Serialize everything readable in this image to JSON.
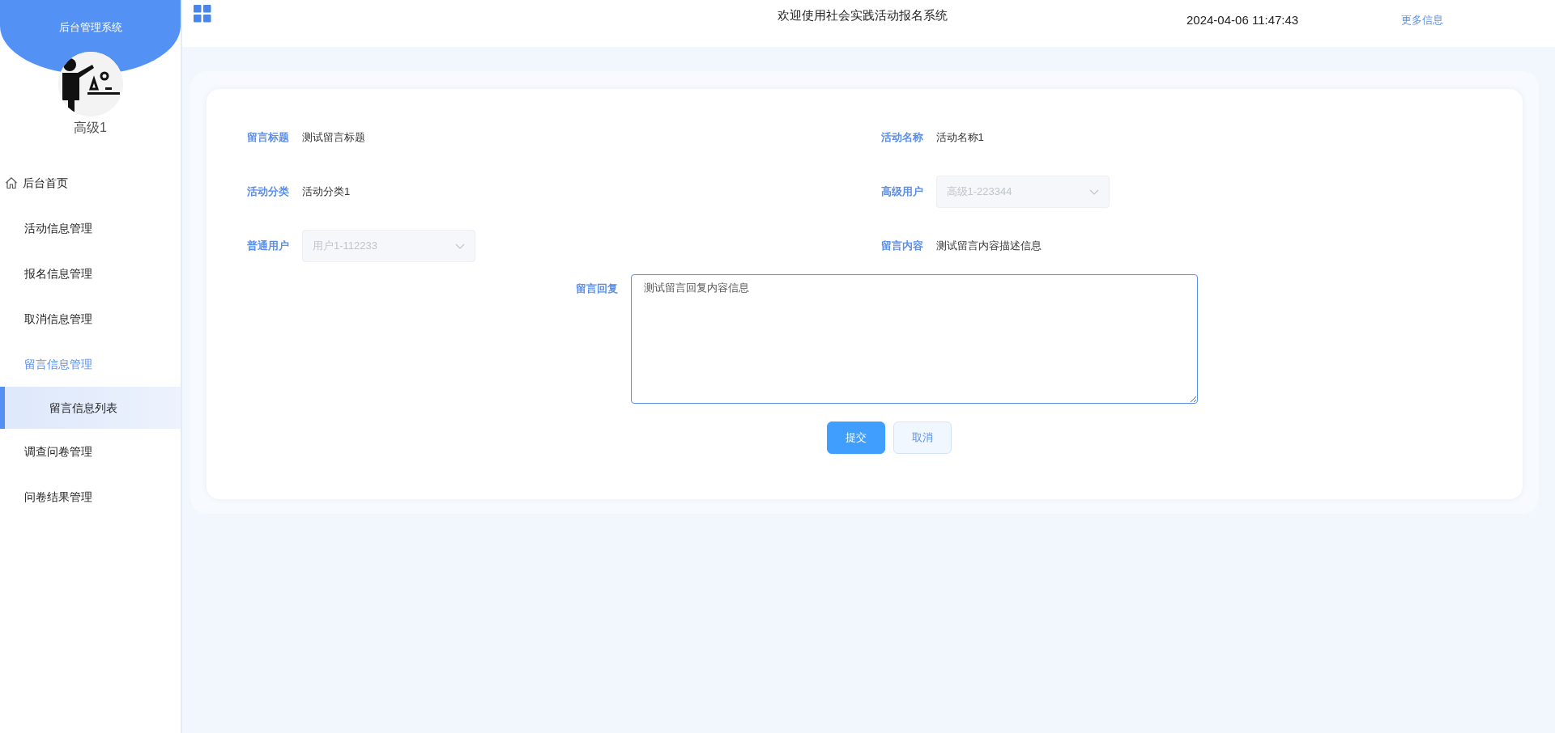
{
  "sidebar": {
    "title": "后台管理系统",
    "user": "高级1",
    "menu": [
      {
        "label": "后台首页",
        "kind": "home",
        "selected": false,
        "expanded": false
      },
      {
        "label": "活动信息管理",
        "kind": "group",
        "selected": false,
        "expanded": false
      },
      {
        "label": "报名信息管理",
        "kind": "group",
        "selected": false,
        "expanded": false
      },
      {
        "label": "取消信息管理",
        "kind": "group",
        "selected": false,
        "expanded": false
      },
      {
        "label": "留言信息管理",
        "kind": "group",
        "selected": false,
        "expanded": true,
        "children": [
          {
            "label": "留言信息列表",
            "selected": true
          }
        ]
      },
      {
        "label": "调查问卷管理",
        "kind": "group",
        "selected": false,
        "expanded": false
      },
      {
        "label": "问卷结果管理",
        "kind": "group",
        "selected": false,
        "expanded": false
      }
    ]
  },
  "header": {
    "welcome": "欢迎使用社会实践活动报名系统",
    "datetime": "2024-04-06 11:47:43",
    "more_link": "更多信息"
  },
  "form": {
    "fields": [
      {
        "label": "留言标题",
        "kind": "text",
        "value": "测试留言标题"
      },
      {
        "label": "活动名称",
        "kind": "text",
        "value": "活动名称1"
      },
      {
        "label": "活动分类",
        "kind": "text",
        "value": "活动分类1"
      },
      {
        "label": "高级用户",
        "kind": "select",
        "value": "高级1-223344",
        "disabled": true
      },
      {
        "label": "普通用户",
        "kind": "select",
        "value": "用户1-112233",
        "disabled": true
      },
      {
        "label": "留言内容",
        "kind": "text",
        "value": "测试留言内容描述信息"
      }
    ],
    "reply": {
      "label": "留言回复",
      "value": "测试留言回复内容信息"
    },
    "buttons": [
      {
        "label": "提交",
        "kind": "primary"
      },
      {
        "label": "取消",
        "kind": "default"
      }
    ]
  }
}
